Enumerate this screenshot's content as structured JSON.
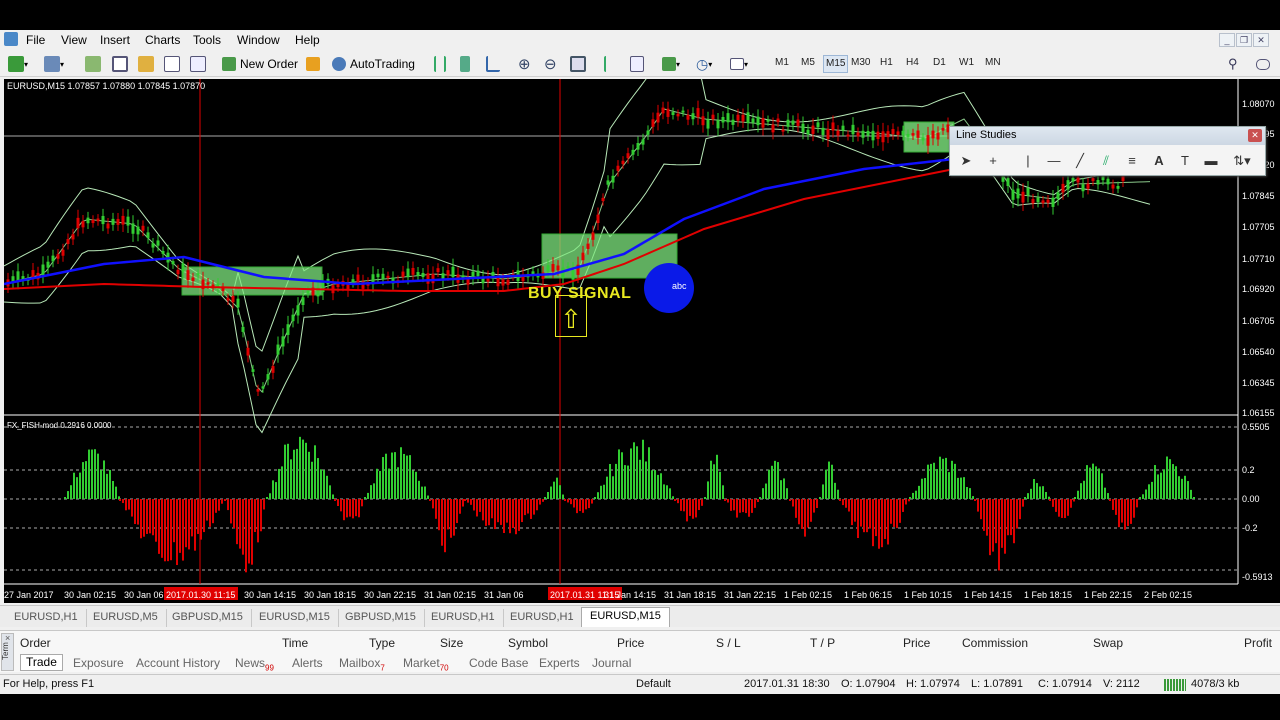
{
  "menu": {
    "file": "File",
    "view": "View",
    "insert": "Insert",
    "charts": "Charts",
    "tools": "Tools",
    "window": "Window",
    "help": "Help"
  },
  "toolbar": {
    "new_order": "New Order",
    "auto_trading": "AutoTrading",
    "timeframes": [
      "M1",
      "M5",
      "M15",
      "M30",
      "H1",
      "H4",
      "D1",
      "W1",
      "MN"
    ],
    "active_timeframe": "M15"
  },
  "chart": {
    "header": "EURUSD,M15  1.07857  1.07880  1.07845  1.07870",
    "price_labels": [
      "1.08070",
      "1.07995",
      "1.07920",
      "1.07845",
      "1.07705",
      "1.07710",
      "1.06920",
      "1.06705",
      "1.06540",
      "1.06345",
      "1.06155"
    ],
    "buy_signal": "BUY SIGNAL",
    "abc_label": "abc",
    "indicator_header": "FX_FISH-mod 0.2916 0.0000",
    "indicator_labels": [
      "0.5505",
      "0.2",
      "0.00",
      "-0.2",
      "-0.5913"
    ],
    "time_labels": [
      "27 Jan 2017",
      "30 Jan 02:15",
      "30 Jan 06",
      "2017.01.30 11:15",
      "30 Jan 14:15",
      "30 Jan 18:15",
      "30 Jan 22:15",
      "31 Jan 02:15",
      "31 Jan 06",
      "2017.01.31 11:15",
      "31 Jan 14:15",
      "31 Jan 18:15",
      "31 Jan 22:15",
      "1 Feb 02:15",
      "1 Feb 06:15",
      "1 Feb 10:15",
      "1 Feb 14:15",
      "1 Feb 18:15",
      "1 Feb 22:15",
      "2 Feb 02:15"
    ],
    "colors": {
      "bull": "#32cd32",
      "bear": "#e00000",
      "ma_blue": "#1010ff",
      "ma_red": "#e00000",
      "background": "#000000"
    }
  },
  "line_studies": {
    "title": "Line Studies",
    "tools": [
      "cursor-icon",
      "crosshair-icon",
      "vertical-line-icon",
      "horizontal-line-icon",
      "trendline-icon",
      "channel-icon",
      "fibonacci-icon",
      "text-icon",
      "text-label-icon",
      "rectangle-icon",
      "arrow-icon"
    ]
  },
  "chart_tabs": [
    "EURUSD,H1",
    "EURUSD,M5",
    "GBPUSD,M15",
    "EURUSD,M15",
    "GBPUSD,M15",
    "EURUSD,H1",
    "EURUSD,H1",
    "EURUSD,M15"
  ],
  "active_chart_tab": "EURUSD,M15",
  "terminal": {
    "columns": [
      "Order",
      "Time",
      "Type",
      "Size",
      "Symbol",
      "Price",
      "S / L",
      "T / P",
      "Price",
      "Commission",
      "Swap",
      "Profit"
    ],
    "side_label": "Term",
    "tabs": [
      {
        "label": "Trade",
        "badge": ""
      },
      {
        "label": "Exposure",
        "badge": ""
      },
      {
        "label": "Account History",
        "badge": ""
      },
      {
        "label": "News",
        "badge": "99"
      },
      {
        "label": "Alerts",
        "badge": ""
      },
      {
        "label": "Mailbox",
        "badge": "7"
      },
      {
        "label": "Market",
        "badge": "70"
      },
      {
        "label": "Code Base",
        "badge": ""
      },
      {
        "label": "Experts",
        "badge": ""
      },
      {
        "label": "Journal",
        "badge": ""
      }
    ]
  },
  "status": {
    "help": "For Help, press F1",
    "profile": "Default",
    "datetime": "2017.01.31 18:30",
    "open": "O: 1.07904",
    "high": "H: 1.07974",
    "low": "L: 1.07891",
    "close": "C: 1.07914",
    "volume": "V: 2112",
    "traffic": "4078/3 kb"
  }
}
